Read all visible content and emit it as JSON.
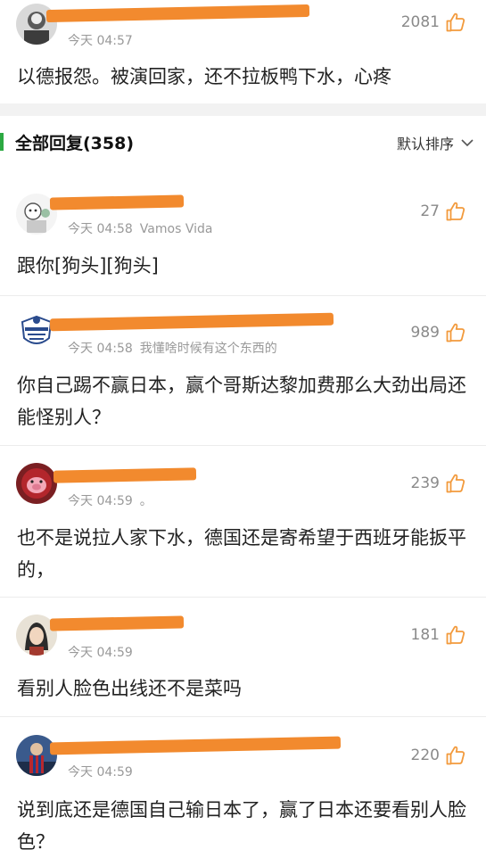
{
  "top_comment": {
    "time": "今天 04:57",
    "likes": "2081",
    "text": "以德报怨。被演回家，还不拉板鸭下水，心疼"
  },
  "section": {
    "title": "全部回复(358)",
    "sort_label": "默认排序"
  },
  "replies": [
    {
      "time": "今天 04:58",
      "device": "Vamos Vida",
      "likes": "27",
      "text": "跟你[狗头][狗头]"
    },
    {
      "time": "今天 04:58",
      "device": "我懂啥时候有这个东西的",
      "likes": "989",
      "text": "你自己踢不赢日本，赢个哥斯达黎加费那么大劲出局还能怪别人？"
    },
    {
      "time": "今天 04:59",
      "device": "。",
      "likes": "239",
      "text": "也不是说拉人家下水，德国还是寄希望于西班牙能扳平的，"
    },
    {
      "time": "今天 04:59",
      "device": "",
      "likes": "181",
      "text": "看别人脸色出线还不是菜吗"
    },
    {
      "time": "今天 04:59",
      "device": "",
      "likes": "220",
      "text": "说到底还是德国自己输日本了，赢了日本还要看别人脸色？"
    }
  ],
  "colors": {
    "accent": "#2ca942",
    "redaction": "#f28a2e",
    "meta": "#999999"
  }
}
